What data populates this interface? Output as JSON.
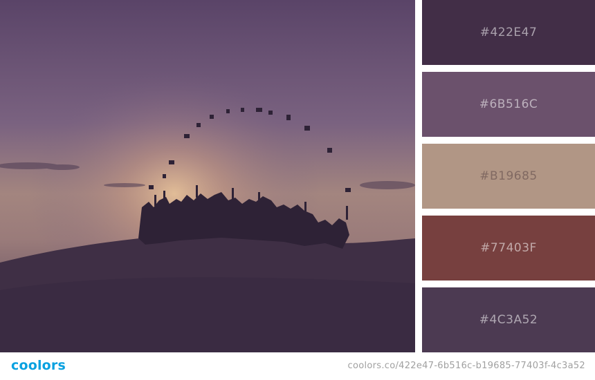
{
  "photo": {
    "description_tag": "graduation-silhouette"
  },
  "palette": [
    {
      "hex": "#422E47",
      "color": "#422e47"
    },
    {
      "hex": "#6B516C",
      "color": "#6b516c"
    },
    {
      "hex": "#B19685",
      "color": "#b19685"
    },
    {
      "hex": "#77403F",
      "color": "#77403f"
    },
    {
      "hex": "#4C3A52",
      "color": "#4c3a52"
    }
  ],
  "footer": {
    "brand": "coolors",
    "url": "coolors.co/422e47-6b516c-b19685-77403f-4c3a52"
  }
}
